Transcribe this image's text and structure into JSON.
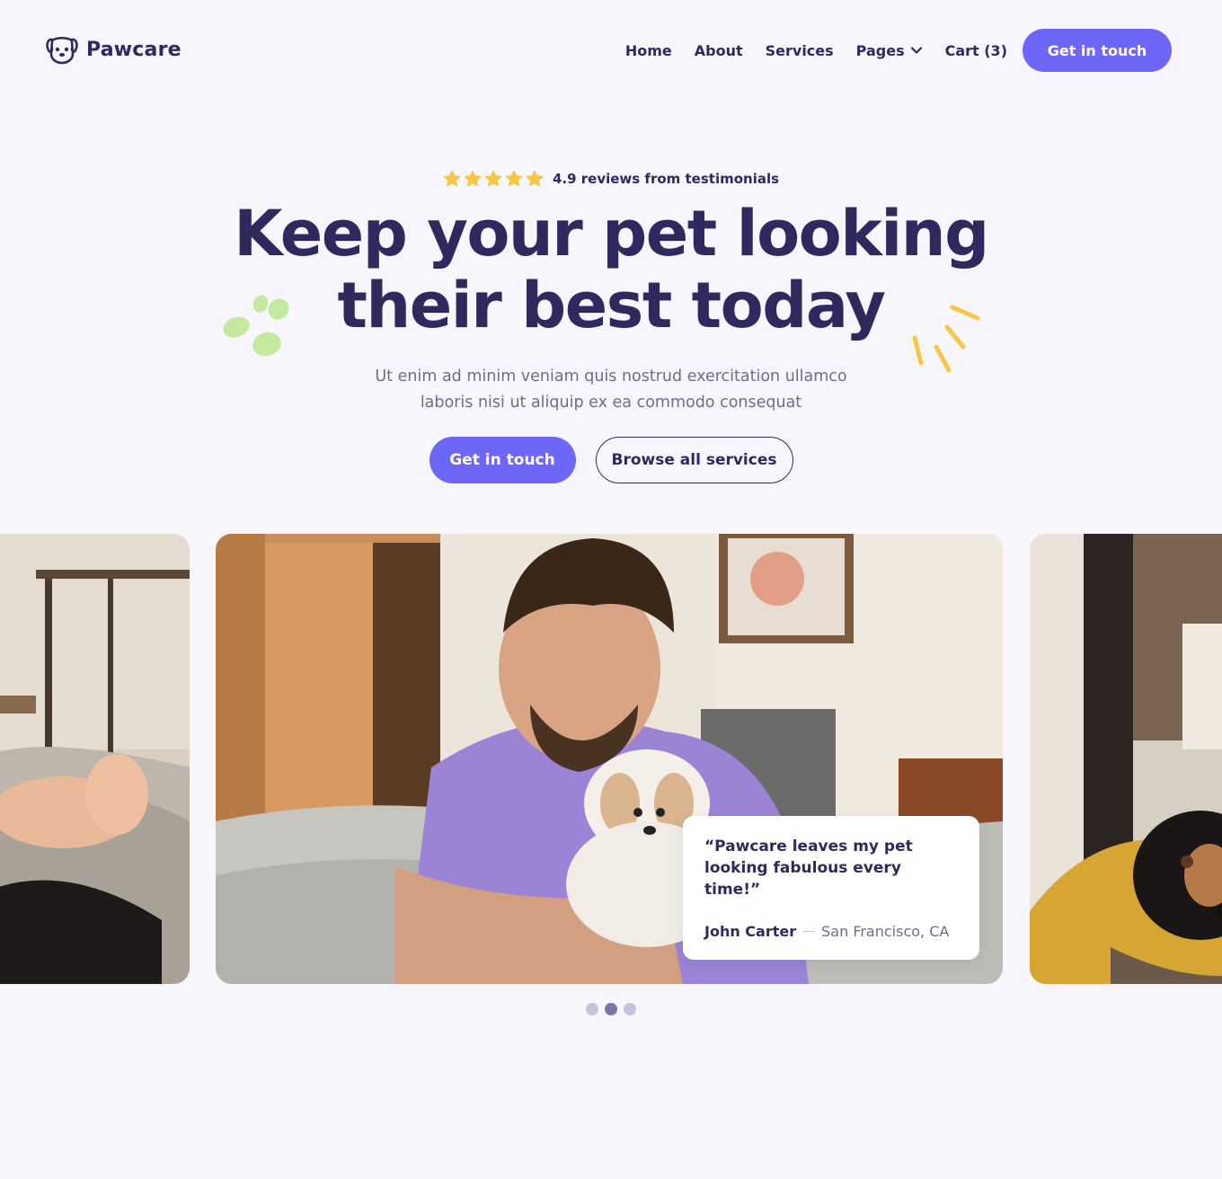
{
  "header": {
    "logo_text": "Pawcare",
    "nav": [
      {
        "label": "Home"
      },
      {
        "label": "About"
      },
      {
        "label": "Services"
      },
      {
        "label": "Pages",
        "has_dropdown": true
      },
      {
        "label": "Cart (3)"
      }
    ],
    "cta_label": "Get in touch"
  },
  "hero": {
    "rating_stars": 5,
    "rating_text": "4.9 reviews from testimonials",
    "headline_line1": "Keep your pet looking",
    "headline_line2": "their best today",
    "subtext_line1": "Ut enim ad minim veniam quis nostrud exercitation ullamco",
    "subtext_line2": "laboris nisi ut aliquip ex ea commodo consequat",
    "primary_button": "Get in touch",
    "secondary_button": "Browse all services"
  },
  "carousel": {
    "testimonial_quote": "“Pawcare leaves my pet looking fabulous every time!”",
    "author_name": "John Carter",
    "author_location": "San Francisco, CA",
    "dots_count": 3,
    "active_dot": 1
  },
  "colors": {
    "brand_primary": "#6e66f6",
    "text_dark": "#2f2a5e",
    "star": "#f8c544",
    "accent_green": "#c6e9a0",
    "accent_yellow": "#f8c544",
    "background": "#f7f6fc"
  },
  "icons": [
    "paw-logo-icon",
    "chevron-down-icon",
    "star-icon",
    "paw-prints-decoration",
    "sparkle-lines-decoration"
  ]
}
